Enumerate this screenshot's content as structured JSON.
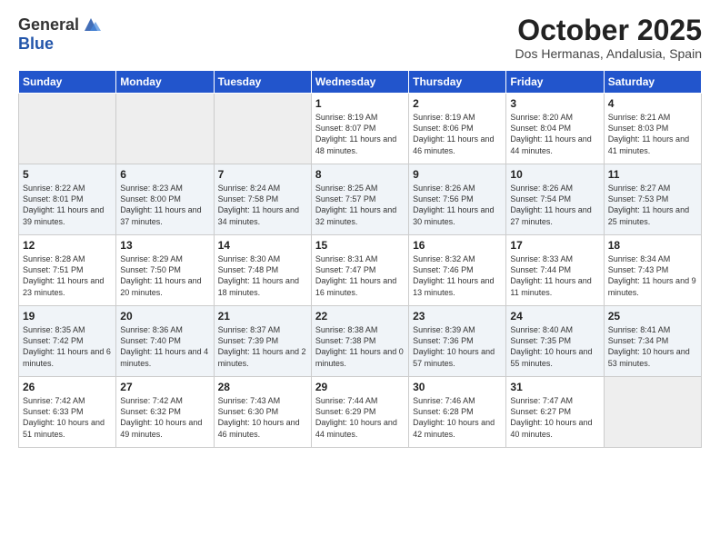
{
  "logo": {
    "text_general": "General",
    "text_blue": "Blue"
  },
  "title": "October 2025",
  "location": "Dos Hermanas, Andalusia, Spain",
  "days_of_week": [
    "Sunday",
    "Monday",
    "Tuesday",
    "Wednesday",
    "Thursday",
    "Friday",
    "Saturday"
  ],
  "weeks": [
    [
      {
        "day": "",
        "empty": true
      },
      {
        "day": "",
        "empty": true
      },
      {
        "day": "",
        "empty": true
      },
      {
        "day": "1",
        "sunrise": "8:19 AM",
        "sunset": "8:07 PM",
        "daylight": "11 hours and 48 minutes."
      },
      {
        "day": "2",
        "sunrise": "8:19 AM",
        "sunset": "8:06 PM",
        "daylight": "11 hours and 46 minutes."
      },
      {
        "day": "3",
        "sunrise": "8:20 AM",
        "sunset": "8:04 PM",
        "daylight": "11 hours and 44 minutes."
      },
      {
        "day": "4",
        "sunrise": "8:21 AM",
        "sunset": "8:03 PM",
        "daylight": "11 hours and 41 minutes."
      }
    ],
    [
      {
        "day": "5",
        "sunrise": "8:22 AM",
        "sunset": "8:01 PM",
        "daylight": "11 hours and 39 minutes."
      },
      {
        "day": "6",
        "sunrise": "8:23 AM",
        "sunset": "8:00 PM",
        "daylight": "11 hours and 37 minutes."
      },
      {
        "day": "7",
        "sunrise": "8:24 AM",
        "sunset": "7:58 PM",
        "daylight": "11 hours and 34 minutes."
      },
      {
        "day": "8",
        "sunrise": "8:25 AM",
        "sunset": "7:57 PM",
        "daylight": "11 hours and 32 minutes."
      },
      {
        "day": "9",
        "sunrise": "8:26 AM",
        "sunset": "7:56 PM",
        "daylight": "11 hours and 30 minutes."
      },
      {
        "day": "10",
        "sunrise": "8:26 AM",
        "sunset": "7:54 PM",
        "daylight": "11 hours and 27 minutes."
      },
      {
        "day": "11",
        "sunrise": "8:27 AM",
        "sunset": "7:53 PM",
        "daylight": "11 hours and 25 minutes."
      }
    ],
    [
      {
        "day": "12",
        "sunrise": "8:28 AM",
        "sunset": "7:51 PM",
        "daylight": "11 hours and 23 minutes."
      },
      {
        "day": "13",
        "sunrise": "8:29 AM",
        "sunset": "7:50 PM",
        "daylight": "11 hours and 20 minutes."
      },
      {
        "day": "14",
        "sunrise": "8:30 AM",
        "sunset": "7:48 PM",
        "daylight": "11 hours and 18 minutes."
      },
      {
        "day": "15",
        "sunrise": "8:31 AM",
        "sunset": "7:47 PM",
        "daylight": "11 hours and 16 minutes."
      },
      {
        "day": "16",
        "sunrise": "8:32 AM",
        "sunset": "7:46 PM",
        "daylight": "11 hours and 13 minutes."
      },
      {
        "day": "17",
        "sunrise": "8:33 AM",
        "sunset": "7:44 PM",
        "daylight": "11 hours and 11 minutes."
      },
      {
        "day": "18",
        "sunrise": "8:34 AM",
        "sunset": "7:43 PM",
        "daylight": "11 hours and 9 minutes."
      }
    ],
    [
      {
        "day": "19",
        "sunrise": "8:35 AM",
        "sunset": "7:42 PM",
        "daylight": "11 hours and 6 minutes."
      },
      {
        "day": "20",
        "sunrise": "8:36 AM",
        "sunset": "7:40 PM",
        "daylight": "11 hours and 4 minutes."
      },
      {
        "day": "21",
        "sunrise": "8:37 AM",
        "sunset": "7:39 PM",
        "daylight": "11 hours and 2 minutes."
      },
      {
        "day": "22",
        "sunrise": "8:38 AM",
        "sunset": "7:38 PM",
        "daylight": "11 hours and 0 minutes."
      },
      {
        "day": "23",
        "sunrise": "8:39 AM",
        "sunset": "7:36 PM",
        "daylight": "10 hours and 57 minutes."
      },
      {
        "day": "24",
        "sunrise": "8:40 AM",
        "sunset": "7:35 PM",
        "daylight": "10 hours and 55 minutes."
      },
      {
        "day": "25",
        "sunrise": "8:41 AM",
        "sunset": "7:34 PM",
        "daylight": "10 hours and 53 minutes."
      }
    ],
    [
      {
        "day": "26",
        "sunrise": "7:42 AM",
        "sunset": "6:33 PM",
        "daylight": "10 hours and 51 minutes."
      },
      {
        "day": "27",
        "sunrise": "7:42 AM",
        "sunset": "6:32 PM",
        "daylight": "10 hours and 49 minutes."
      },
      {
        "day": "28",
        "sunrise": "7:43 AM",
        "sunset": "6:30 PM",
        "daylight": "10 hours and 46 minutes."
      },
      {
        "day": "29",
        "sunrise": "7:44 AM",
        "sunset": "6:29 PM",
        "daylight": "10 hours and 44 minutes."
      },
      {
        "day": "30",
        "sunrise": "7:46 AM",
        "sunset": "6:28 PM",
        "daylight": "10 hours and 42 minutes."
      },
      {
        "day": "31",
        "sunrise": "7:47 AM",
        "sunset": "6:27 PM",
        "daylight": "10 hours and 40 minutes."
      },
      {
        "day": "",
        "empty": true
      }
    ]
  ]
}
